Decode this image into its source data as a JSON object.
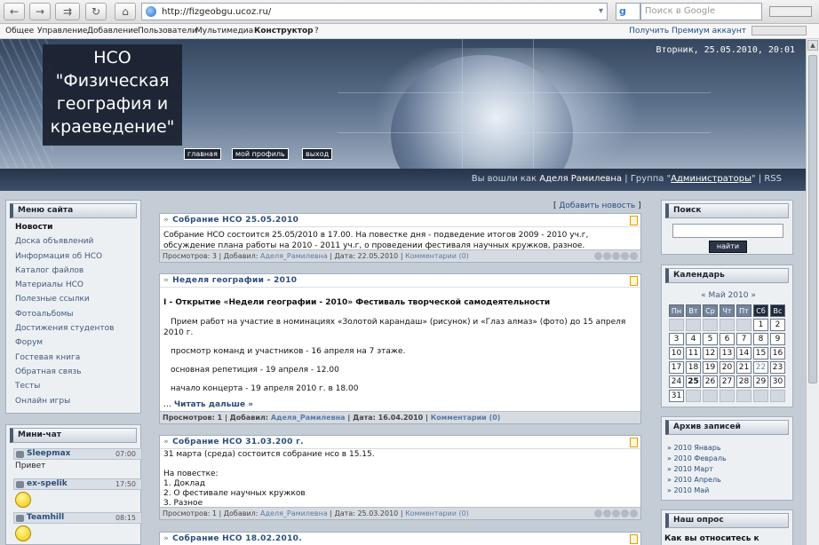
{
  "browser": {
    "url": "http://fizgeobgu.ucoz.ru/",
    "search_placeholder": "Поиск в Google",
    "search_engine_glyph": "g"
  },
  "ucoz_panel": {
    "items": [
      "Общее",
      "Управление",
      "Добавление",
      "Пользователи",
      "Мультимедиа",
      "Конструктор",
      "?"
    ],
    "premium_text": "Получить Премиум аккаунт"
  },
  "header": {
    "title": "НСО \"Физическая география и краеведение\"",
    "datetime": "Вторник, 25.05.2010, 20:01",
    "links": [
      "главная",
      "мой профиль",
      "выход"
    ],
    "login_prefix": "Вы вошли как",
    "login_user": "Аделя Рамилевна",
    "login_group_prefix": "| Группа \"",
    "login_group": "Администраторы",
    "login_group_suffix": "\" |",
    "rss": "RSS"
  },
  "site_menu": {
    "title": "Меню сайта",
    "items": [
      "Новости",
      "Доска объявлений",
      "Информация об НСО",
      "Каталог файлов",
      "Материалы НСО",
      "Полезные ссылки",
      "Фотоальбомы",
      "Достижения студентов",
      "Форум",
      "Гостевая книга",
      "Обратная связь",
      "Тесты",
      "Онлайн игры"
    ]
  },
  "mini_chat": {
    "title": "Мини-чат",
    "messages": [
      {
        "user": "Sleepmax",
        "time": "07:00",
        "text": "Привет"
      },
      {
        "user": "ex-spelik",
        "time": "17:50",
        "text": ""
      },
      {
        "user": "Teamhill",
        "time": "08:15",
        "text": ""
      }
    ]
  },
  "main": {
    "add_news": "Добавить новость",
    "posts": [
      {
        "title": "Собрание НСО 25.05.2010",
        "body": [
          "Собрание НСО состоится 25.05/2010 в 17.00. На повестке дня - подведение итогов 2009 - 2010 уч.г,",
          "обсуждение плана работы на 2010 - 2011 уч.г, о проведении фестиваля научных кружков, разное."
        ],
        "footer": {
          "views": "Просмотров: 3",
          "author_label": "Добавил:",
          "author": "Аделя_Рамилевна",
          "date": "Дата: 22.05.2010",
          "comments": "Комментарии (0)"
        }
      },
      {
        "title": "Неделя географии - 2010",
        "body": [
          "I - Открытие «Недели географии - 2010» Фестиваль творческой самодеятельности",
          "Прием работ на участие в номинациях «Золотой карандаш» (рисунок) и «Глаз алмаз» (фото)  до 15 апреля",
          "2010 г.",
          "просмотр команд и участников - 16 апреля на 7 этаже.",
          "основная репетиция - 19 апреля - 12.00",
          "начало концерта - 19 апреля 2010 г. в 18.00"
        ],
        "read_more": "Читать дальше »",
        "footer": {
          "views": "Просмотров: 1",
          "author_label": "Добавил:",
          "author": "Аделя_Рамилевна",
          "date": "Дата: 16.04.2010",
          "comments": "Комментарии (0)"
        }
      },
      {
        "title": "Собрание НСО 31.03.200 г.",
        "body": [
          "31 марта  (среда) состоится собрание нсо в 15.15.",
          "",
          "На повестке:",
          "1. Доклад",
          "2. О фестивале научных кружков",
          "3. Разное"
        ],
        "footer": {
          "views": "Просмотров: 1",
          "author_label": "Добавил:",
          "author": "Аделя_Рамилевна",
          "date": "Дата: 25.03.2010",
          "comments": "Комментарии (0)"
        }
      },
      {
        "title": "Собрание НСО 18.02.2010."
      }
    ]
  },
  "search_block": {
    "title": "Поиск",
    "button": "найти"
  },
  "calendar": {
    "title": "Календарь",
    "nav_prev": "«",
    "month": "Май 2010",
    "nav_next": "»",
    "dow": [
      "Пн",
      "Вт",
      "Ср",
      "Чт",
      "Пт",
      "Сб",
      "Вс"
    ],
    "weeks": [
      [
        "",
        "",
        "",
        "",
        "",
        "1",
        "2"
      ],
      [
        "3",
        "4",
        "5",
        "6",
        "7",
        "8",
        "9"
      ],
      [
        "10",
        "11",
        "12",
        "13",
        "14",
        "15",
        "16"
      ],
      [
        "17",
        "18",
        "19",
        "20",
        "21",
        "22",
        "23"
      ],
      [
        "24",
        "25",
        "26",
        "27",
        "28",
        "29",
        "30"
      ],
      [
        "31",
        "",
        "",
        "",
        "",
        "",
        ""
      ]
    ],
    "highlighted_day": "22",
    "today": "25"
  },
  "archive": {
    "title": "Архив записей",
    "items": [
      "2010 Январь",
      "2010 Февраль",
      "2010 Март",
      "2010 Апрель",
      "2010 Май"
    ]
  },
  "poll": {
    "title": "Наш опрос",
    "question": "Как вы относитесь к"
  },
  "colors": {
    "header_dark": "#1b2331",
    "link": "#2b4d7c",
    "page_bg": "#c4ccd6"
  }
}
